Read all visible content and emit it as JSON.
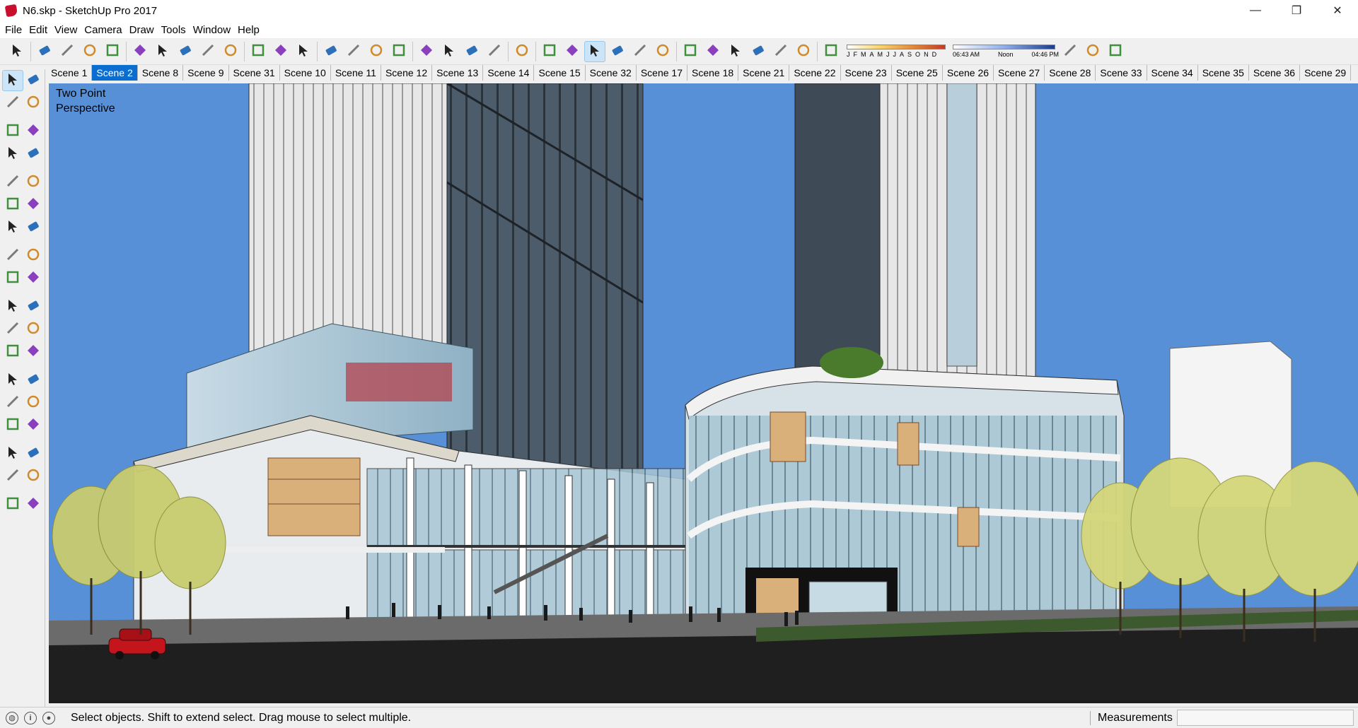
{
  "window": {
    "title": "N6.skp - SketchUp Pro 2017",
    "controls": {
      "minimize": "—",
      "restore": "❐",
      "close": "✕"
    }
  },
  "menu": [
    "File",
    "Edit",
    "View",
    "Camera",
    "Draw",
    "Tools",
    "Window",
    "Help"
  ],
  "toolbar": {
    "icons": [
      "select-icon",
      "eraser-icon",
      "pencil-icon",
      "shapes-icon",
      "paint-bucket-icon",
      "push-pull-icon",
      "follow-me-icon",
      "move-icon",
      "rotate-icon",
      "scale-icon",
      "tape-measure-icon",
      "text-icon",
      "paint-icon",
      "orbit-icon",
      "pan-icon",
      "zoom-icon",
      "zoom-extents-icon",
      "warehouse-icon",
      "extension-warehouse-icon",
      "layout-icon",
      "ruby-icon",
      "xray-icon",
      "back-edges-icon",
      "wireframe-icon",
      "hidden-line-icon",
      "shaded-icon",
      "shaded-textures-icon",
      "monochrome-icon",
      "iso-view-icon",
      "top-view-icon",
      "front-view-icon",
      "right-view-icon",
      "back-view-icon",
      "left-view-icon",
      "shadows-icon"
    ],
    "shadow_months": [
      "J",
      "F",
      "M",
      "A",
      "M",
      "J",
      "J",
      "A",
      "S",
      "O",
      "N",
      "D"
    ],
    "shadow_times": {
      "start": "06:43 AM",
      "mid": "Noon",
      "end": "04:46 PM"
    }
  },
  "scenes": {
    "active": "Scene 2",
    "tabs": [
      "Scene 1",
      "Scene 2",
      "Scene 8",
      "Scene 9",
      "Scene 31",
      "Scene 10",
      "Scene 11",
      "Scene 12",
      "Scene 13",
      "Scene 14",
      "Scene 15",
      "Scene 32",
      "Scene 17",
      "Scene 18",
      "Scene 21",
      "Scene 22",
      "Scene 23",
      "Scene 25",
      "Scene 26",
      "Scene 27",
      "Scene 28",
      "Scene 33",
      "Scene 34",
      "Scene 35",
      "Scene 36",
      "Scene 29"
    ]
  },
  "viewport": {
    "label_line1": "Two Point",
    "label_line2": "Perspective",
    "sky_color": "#5790d6",
    "ground_color": "#1f1f1f"
  },
  "lefttools": [
    "select",
    "component",
    "paint",
    "eraser",
    "line",
    "freehand",
    "rectangle",
    "rotated-rectangle",
    "circle",
    "polygon",
    "arc",
    "pie",
    "3pt-arc",
    "2pt-arc",
    "move",
    "push-pull",
    "rotate",
    "follow-me",
    "scale",
    "offset",
    "tape",
    "dimension",
    "protractor",
    "text",
    "axes",
    "3d-text",
    "orbit",
    "pan",
    "zoom",
    "zoom-window",
    "zoom-extents",
    "previous",
    "position-camera",
    "look-around",
    "walk",
    "section-plane"
  ],
  "status": {
    "message": "Select objects. Shift to extend select. Drag mouse to select multiple.",
    "measurements_label": "Measurements",
    "measurements_value": ""
  }
}
